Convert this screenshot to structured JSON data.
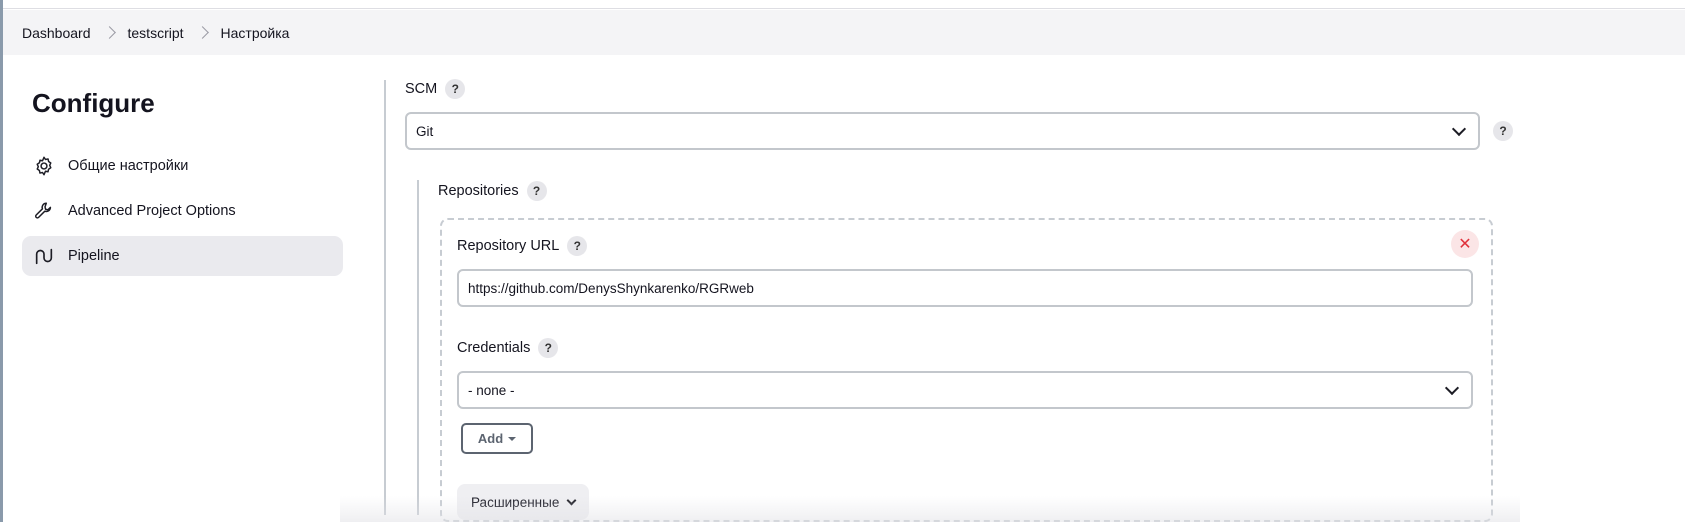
{
  "breadcrumb": {
    "items": [
      "Dashboard",
      "testscript",
      "Настройка"
    ]
  },
  "sidebar": {
    "title": "Configure",
    "items": [
      {
        "label": "Общие настройки",
        "icon": "gear-icon",
        "active": false
      },
      {
        "label": "Advanced Project Options",
        "icon": "wrench-icon",
        "active": false
      },
      {
        "label": "Pipeline",
        "icon": "pipeline-icon",
        "active": true
      }
    ]
  },
  "scm": {
    "label": "SCM",
    "help": "?",
    "selected": "Git",
    "select_help": "?"
  },
  "repositories": {
    "label": "Repositories",
    "help": "?",
    "remove_icon": "✕",
    "url_label": "Repository URL",
    "url_help": "?",
    "url_value": "https://github.com/DenysShynkarenko/RGRweb",
    "credentials_label": "Credentials",
    "credentials_help": "?",
    "credentials_selected": "- none -",
    "add_label": "Add",
    "advanced_label": "Расширенные"
  },
  "colors": {
    "accent_danger": "#e0313b",
    "active_bg": "#eaeaee",
    "breadcrumb_bg": "#f4f4f6"
  }
}
